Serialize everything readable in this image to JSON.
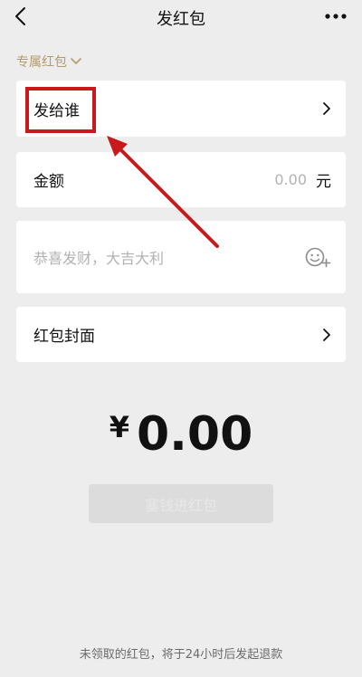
{
  "nav": {
    "title": "发红包",
    "back_icon": "chevron-left-icon",
    "more_icon": "ellipsis-icon"
  },
  "packet_type": {
    "label": "专属红包"
  },
  "recipient": {
    "label": "发给谁"
  },
  "amount": {
    "label": "金额",
    "value": "0.00",
    "unit": "元"
  },
  "greeting": {
    "placeholder": "恭喜发财，大吉大利",
    "emoji_icon": "emoji-add-icon"
  },
  "cover": {
    "label": "红包封面"
  },
  "total": {
    "currency": "¥",
    "value": "0.00"
  },
  "submit": {
    "label": "塞钱进红包"
  },
  "footer": {
    "note": "未领取的红包，将于24小时后发起退款"
  },
  "colors": {
    "background": "#ededed",
    "accent_gold": "#b59b6c",
    "annotation_red": "#c8191c",
    "muted_text": "#b2b2b2"
  }
}
